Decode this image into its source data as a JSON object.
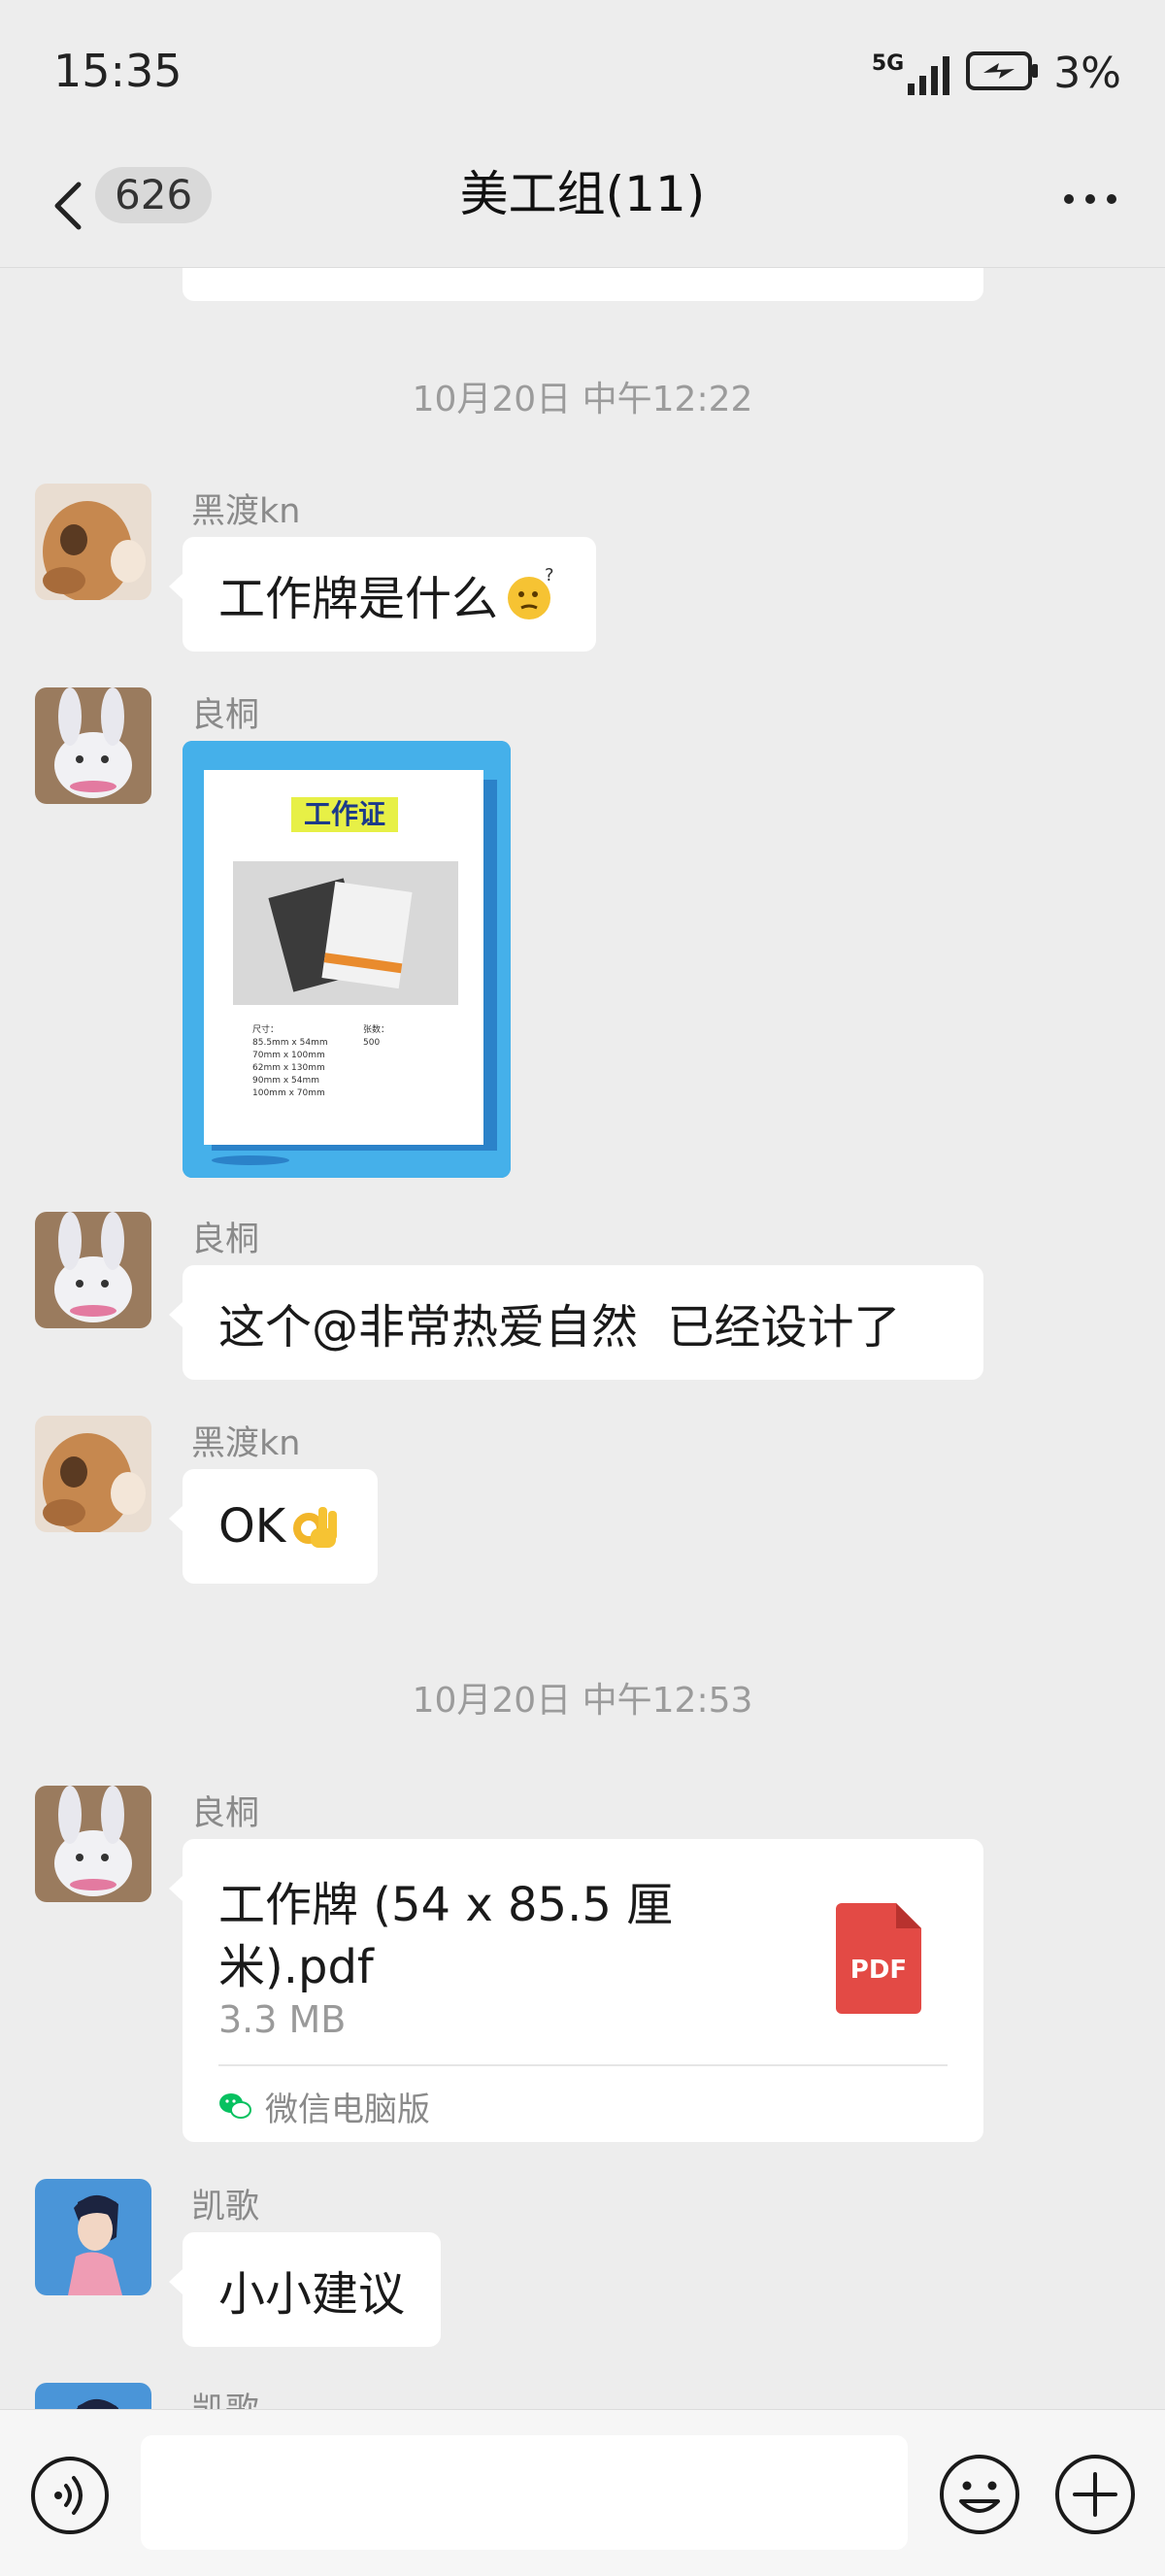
{
  "status_bar": {
    "time": "15:35",
    "network": "5G",
    "battery": "3%"
  },
  "header": {
    "unread_count": "626",
    "title": "美工组(11)"
  },
  "messages": [
    {
      "type": "timestamp",
      "text": "10月20日 中午12:22"
    },
    {
      "type": "text",
      "sender": "黑渡kn",
      "text": "工作牌是什么",
      "emoji": "thinking-face-emoji"
    },
    {
      "type": "image",
      "sender": "良桐",
      "image": {
        "heading": "工作证",
        "spec_label": "尺寸：",
        "spec_lines": [
          "85.5mm x 54mm",
          "70mm x 100mm",
          "62mm x 130mm",
          "90mm x 54mm",
          "100mm x 70mm"
        ],
        "qty_label": "张数：",
        "qty_value": "500"
      }
    },
    {
      "type": "text",
      "sender": "良桐",
      "text": "这个@非常热爱自然  已经设计了"
    },
    {
      "type": "text",
      "sender": "黑渡kn",
      "text": "OK",
      "emoji": "ok-hand-emoji"
    },
    {
      "type": "timestamp",
      "text": "10月20日 中午12:53"
    },
    {
      "type": "file",
      "sender": "良桐",
      "file_name": "工作牌 (54 x 85.5 厘米).pdf",
      "file_size": "3.3 MB",
      "file_type": "PDF",
      "source": "微信电脑版"
    },
    {
      "type": "text",
      "sender": "凯歌",
      "text": "小小建议"
    },
    {
      "type": "partial",
      "sender": "凯歌"
    }
  ],
  "input": {
    "placeholder": ""
  },
  "colors": {
    "background": "#ededed",
    "bubble": "#ffffff",
    "pdf_red": "#e34a45",
    "wechat_green": "#07c160"
  }
}
